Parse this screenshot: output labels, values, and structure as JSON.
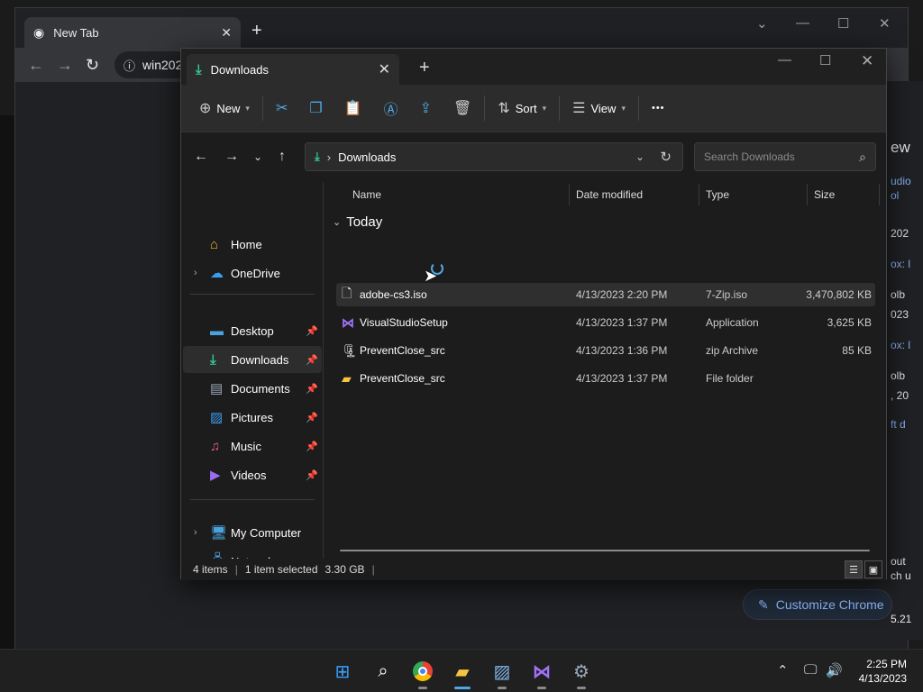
{
  "chrome": {
    "tab_title": "New Tab",
    "tab_close": "✕",
    "new_tab": "+",
    "omnibox": "win202",
    "customize_label": "Customize Chrome",
    "right_fragments": [
      {
        "t": "ew",
        "blue": false
      },
      {
        "t": "udio",
        "blue": true
      },
      {
        "t": "ol",
        "blue": true
      },
      {
        "t": "202",
        "blue": false
      },
      {
        "t": "ox: l",
        "blue": true
      },
      {
        "t": "olb",
        "blue": false
      },
      {
        "t": "023",
        "blue": false
      },
      {
        "t": "ox: l",
        "blue": true
      },
      {
        "t": "olb",
        "blue": false
      },
      {
        "t": ", 20",
        "blue": false
      },
      {
        "t": "ft d",
        "blue": true
      },
      {
        "t": "out",
        "blue": false
      },
      {
        "t": "ch u",
        "blue": false
      },
      {
        "t": "5.21",
        "blue": false
      }
    ]
  },
  "explorer": {
    "tab_title": "Downloads",
    "tab_close": "✕",
    "new_tab": "+",
    "commands": {
      "new_label": "New",
      "sort_label": "Sort",
      "view_label": "View",
      "more_label": "•••"
    },
    "address": {
      "location": "Downloads",
      "search_placeholder": "Search Downloads"
    },
    "nav": {
      "home": "Home",
      "onedrive": "OneDrive",
      "desktop": "Desktop",
      "downloads": "Downloads",
      "documents": "Documents",
      "pictures": "Pictures",
      "music": "Music",
      "videos": "Videos",
      "my_computer": "My Computer",
      "network": "Network"
    },
    "columns": {
      "name": "Name",
      "date": "Date modified",
      "type": "Type",
      "size": "Size"
    },
    "group_label": "Today",
    "files": [
      {
        "name": "adobe-cs3.iso",
        "date": "4/13/2023 2:20 PM",
        "type": "7-Zip.iso",
        "size": "3,470,802 KB",
        "icon": "file-icon"
      },
      {
        "name": "VisualStudioSetup",
        "date": "4/13/2023 1:37 PM",
        "type": "Application",
        "size": "3,625 KB",
        "icon": "visual-studio-icon"
      },
      {
        "name": "PreventClose_src",
        "date": "4/13/2023 1:36 PM",
        "type": "zip Archive",
        "size": "85 KB",
        "icon": "zip-archive-icon"
      },
      {
        "name": "PreventClose_src",
        "date": "4/13/2023 1:37 PM",
        "type": "File folder",
        "size": "",
        "icon": "folder-icon"
      }
    ],
    "status": {
      "items": "4 items",
      "selected": "1 item selected",
      "selected_size": "3.30 GB",
      "divider": "|"
    }
  },
  "taskbar": {
    "time": "2:25 PM",
    "date": "4/13/2023"
  }
}
